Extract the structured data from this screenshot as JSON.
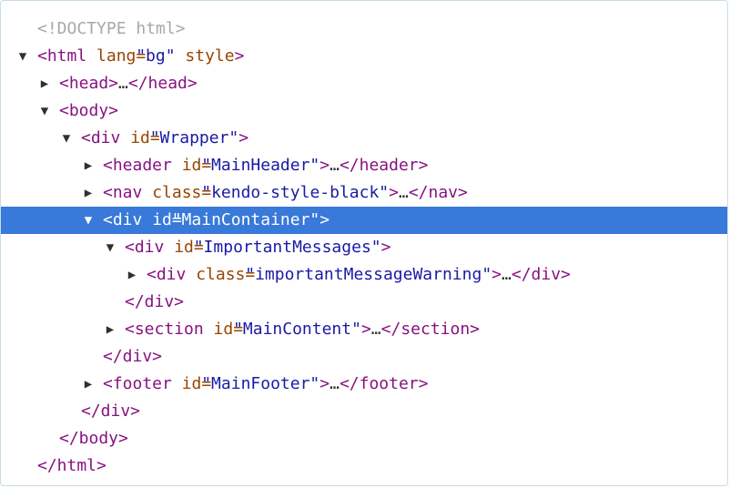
{
  "doctype": "<!DOCTYPE html>",
  "nodes": {
    "html_open": {
      "tag": "<html",
      "attr": "lang=",
      "val": "\"bg\"",
      "attr2": "style",
      "close": ">"
    },
    "head": {
      "open": "<head>",
      "ellipsis": "…",
      "close": "</head>"
    },
    "body_open": "<body>",
    "wrapper_open": {
      "tag": "<div",
      "attr": "id=",
      "val": "\"Wrapper\"",
      "close": ">"
    },
    "header": {
      "tag": "<header",
      "attr": "id=",
      "val": "\"MainHeader\"",
      "gt": ">",
      "ellipsis": "…",
      "close": "</header>"
    },
    "nav": {
      "tag": "<nav",
      "attr": "class=",
      "val": "\"kendo-style-black\"",
      "gt": ">",
      "ellipsis": "…",
      "close": "</nav>"
    },
    "main_container_open": {
      "tag": "<div",
      "attr": "id=",
      "val": "\"MainContainer\"",
      "close": ">"
    },
    "important_open": {
      "tag": "<div",
      "attr": "id=",
      "val": "\"ImportantMessages\"",
      "close": ">"
    },
    "warning": {
      "tag": "<div",
      "attr": "class=",
      "val": "\"importantMessageWarning\"",
      "gt": ">",
      "ellipsis": "…",
      "close": "</div>"
    },
    "important_close": "</div>",
    "section": {
      "tag": "<section",
      "attr": "id=",
      "val": "\"MainContent\"",
      "gt": ">",
      "ellipsis": "…",
      "close": "</section>"
    },
    "main_container_close": "</div>",
    "footer": {
      "tag": "<footer",
      "attr": "id=",
      "val": "\"MainFooter\"",
      "gt": ">",
      "ellipsis": "…",
      "close": "</footer>"
    },
    "wrapper_close": "</div>",
    "body_close": "</body>",
    "html_close": "</html>"
  },
  "colors": {
    "tag": "#881280",
    "attr_name": "#994500",
    "attr_value": "#1a1aa6",
    "doctype": "#a8a8a8",
    "selection": "#3879d9"
  }
}
